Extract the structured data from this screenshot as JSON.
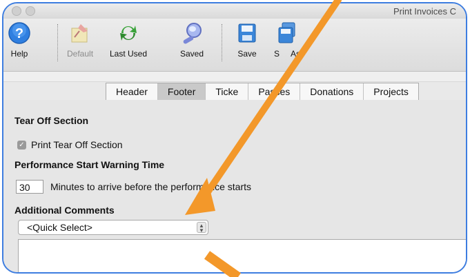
{
  "window": {
    "title": "Print Invoices C"
  },
  "toolbar": {
    "help_label": "Help",
    "default_label": "Default",
    "last_used_label": "Last Used",
    "saved_label": "Saved",
    "save_label": "Save",
    "save_as_label": "S     As"
  },
  "tabs": [
    "Header",
    "Footer",
    "Ticke",
    "Passes",
    "Donations",
    "Projects"
  ],
  "active_tab": "Footer",
  "tear_off": {
    "heading": "Tear Off Section",
    "checkbox_label": "Print Tear Off Section",
    "checked": true
  },
  "warning": {
    "heading": "Performance Start Warning Time",
    "minutes_value": "30",
    "minutes_text": "Minutes to arrive before the performance starts"
  },
  "comments": {
    "heading": "Additional Comments",
    "select_value": "<Quick Select>"
  },
  "colors": {
    "annotation_arrow": "#f3982a",
    "frame_border": "#3d7de0"
  }
}
